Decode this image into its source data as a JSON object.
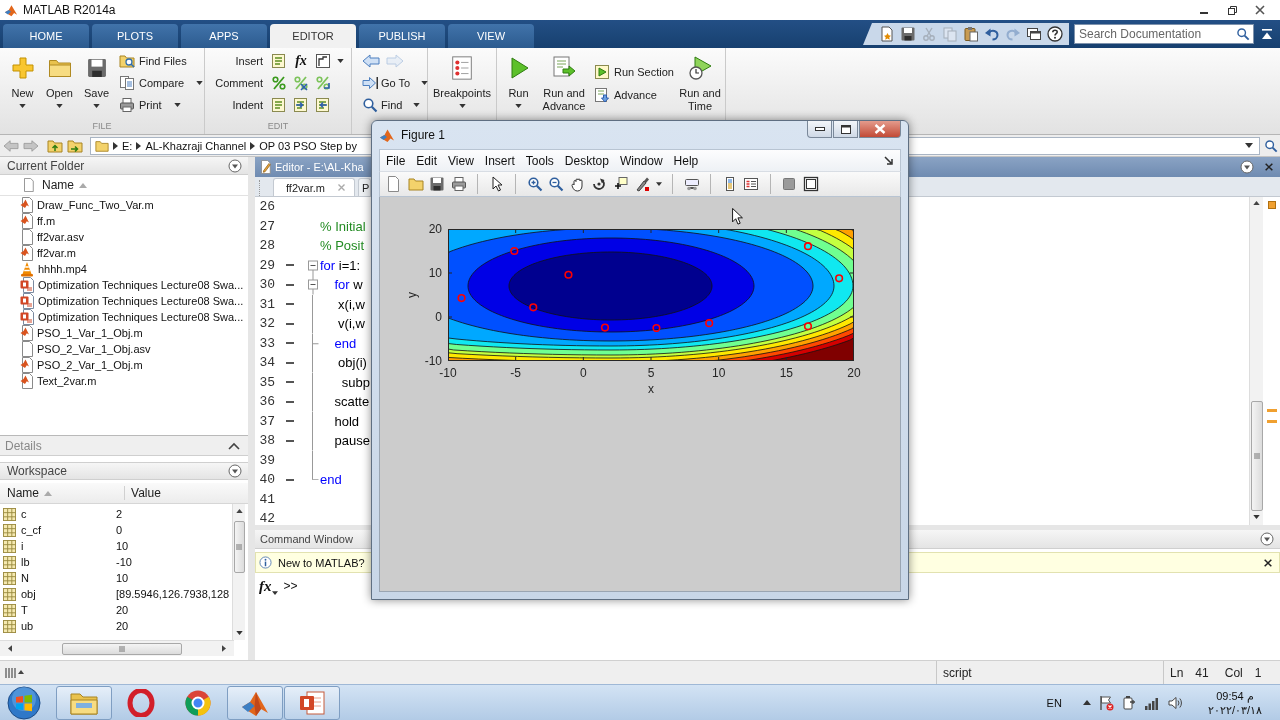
{
  "window": {
    "title": "MATLAB R2014a"
  },
  "ribbon_tabs": [
    {
      "label": "HOME",
      "selected": false
    },
    {
      "label": "PLOTS",
      "selected": false
    },
    {
      "label": "APPS",
      "selected": false
    },
    {
      "label": "EDITOR",
      "selected": true
    },
    {
      "label": "PUBLISH",
      "selected": false
    },
    {
      "label": "VIEW",
      "selected": false
    }
  ],
  "quick_access": [
    {
      "disabled": false
    },
    {
      "disabled": false
    },
    {
      "disabled": true
    },
    {
      "disabled": true
    },
    {
      "disabled": false
    },
    {
      "disabled": false
    },
    {
      "disabled": true
    },
    {
      "disabled": false
    },
    {
      "disabled": false
    }
  ],
  "search": {
    "placeholder": "Search Documentation"
  },
  "toolstrip": {
    "file": {
      "label": "FILE",
      "large_buttons": [
        {
          "label": "New",
          "dropdown": true
        },
        {
          "label": "Open",
          "dropdown": true
        },
        {
          "label": "Save",
          "dropdown": true
        }
      ],
      "small_buttons": [
        {
          "label": "Find Files",
          "dropdown": false
        },
        {
          "label": "Compare",
          "dropdown": true
        },
        {
          "label": "Print",
          "dropdown": true
        }
      ]
    },
    "edit": {
      "label": "EDIT",
      "function_glyph": "fx",
      "rows": [
        {
          "label": "Insert",
          "dropdown": true
        },
        {
          "label": "Comment",
          "dropdown": false
        },
        {
          "label": "Indent",
          "dropdown": false
        }
      ]
    },
    "navigate": {
      "arrows": [
        {
          "disabled": false
        },
        {
          "disabled": true
        }
      ],
      "buttons": [
        {
          "label": "Go To",
          "dropdown": true
        },
        {
          "label": "Find",
          "dropdown": true
        }
      ]
    },
    "breakpoints": {
      "label": "Breakpoints",
      "dropdown": true
    },
    "run": {
      "large_buttons": [
        {
          "label": "Run",
          "dropdown": true
        },
        {
          "label": "Run and Advance",
          "dropdown": false
        }
      ],
      "small_buttons": [
        {
          "label": "Run Section"
        },
        {
          "label": "Advance"
        }
      ],
      "timed": {
        "label": "Run and Time"
      }
    }
  },
  "address_bar": {
    "path": [
      "E:",
      "AL-Khazraji Channel",
      "OP 03 PSO Step by"
    ]
  },
  "current_folder": {
    "title": "Current Folder",
    "column": "Name",
    "files": [
      {
        "name": "Draw_Func_Two_Var.m",
        "kind": "m_file"
      },
      {
        "name": "ff.m",
        "kind": "m_file"
      },
      {
        "name": "ff2var.asv",
        "kind": "backup"
      },
      {
        "name": "ff2var.m",
        "kind": "m_file"
      },
      {
        "name": "hhhh.mp4",
        "kind": "video"
      },
      {
        "name": "Optimization Techniques Lecture08 Swa...",
        "kind": "presentation"
      },
      {
        "name": "Optimization Techniques Lecture08 Swa...",
        "kind": "presentation"
      },
      {
        "name": "Optimization Techniques Lecture08 Swa...",
        "kind": "presentation"
      },
      {
        "name": "PSO_1_Var_1_Obj.m",
        "kind": "m_file"
      },
      {
        "name": "PSO_2_Var_1_Obj.asv",
        "kind": "backup"
      },
      {
        "name": "PSO_2_Var_1_Obj.m",
        "kind": "m_file"
      },
      {
        "name": "Text_2var.m",
        "kind": "m_file"
      }
    ]
  },
  "details": {
    "title": "Details"
  },
  "workspace": {
    "title": "Workspace",
    "columns": [
      "Name",
      "Value"
    ],
    "rows": [
      {
        "name": "c",
        "value": "2"
      },
      {
        "name": "c_cf",
        "value": "0"
      },
      {
        "name": "i",
        "value": "10"
      },
      {
        "name": "lb",
        "value": "-10"
      },
      {
        "name": "N",
        "value": "10"
      },
      {
        "name": "obj",
        "value": "[89.5946,126.7938,128"
      },
      {
        "name": "T",
        "value": "20"
      },
      {
        "name": "ub",
        "value": "20"
      }
    ]
  },
  "editor": {
    "title": "Editor - E:\\AL-Kha",
    "tabs": [
      {
        "label": "ff2var.m",
        "selected": true
      },
      {
        "label": "P",
        "selected": false
      }
    ],
    "lines": [
      {
        "number": "26",
        "kind": "plain",
        "executable": false
      },
      {
        "number": "27",
        "kind": "plain",
        "executable": false,
        "segments": [
          {
            "text": "% Initial",
            "kind": "comment"
          }
        ]
      },
      {
        "number": "28",
        "kind": "plain",
        "executable": false,
        "segments": [
          {
            "text": "% Posit",
            "kind": "comment"
          }
        ]
      },
      {
        "number": "29",
        "kind": "opener",
        "executable": true,
        "segments": [
          {
            "text": "for",
            "kind": "keyword"
          },
          {
            "text": " i=1:",
            "kind": "plain"
          }
        ]
      },
      {
        "number": "30",
        "kind": "opener",
        "executable": true,
        "segments": [
          {
            "text": "    for",
            "kind": "keyword"
          },
          {
            "text": " w",
            "kind": "plain"
          }
        ]
      },
      {
        "number": "31",
        "kind": "inside",
        "executable": true,
        "segments": [
          {
            "text": "     x(i,w",
            "kind": "plain"
          }
        ]
      },
      {
        "number": "32",
        "kind": "inside",
        "executable": true,
        "segments": [
          {
            "text": "     v(i,w",
            "kind": "plain"
          }
        ]
      },
      {
        "number": "33",
        "kind": "closer",
        "executable": true,
        "segments": [
          {
            "text": "    end",
            "kind": "keyword"
          }
        ]
      },
      {
        "number": "34",
        "kind": "inside",
        "executable": true,
        "segments": [
          {
            "text": "     obj(i)",
            "kind": "plain"
          }
        ]
      },
      {
        "number": "35",
        "kind": "inside",
        "executable": true,
        "segments": [
          {
            "text": "      subp",
            "kind": "plain"
          }
        ]
      },
      {
        "number": "36",
        "kind": "inside",
        "executable": true,
        "segments": [
          {
            "text": "    scatte",
            "kind": "plain"
          }
        ]
      },
      {
        "number": "37",
        "kind": "inside",
        "executable": true,
        "segments": [
          {
            "text": "    hold",
            "kind": "plain"
          }
        ]
      },
      {
        "number": "38",
        "kind": "inside",
        "executable": true,
        "segments": [
          {
            "text": "    pause",
            "kind": "plain"
          }
        ]
      },
      {
        "number": "39",
        "kind": "inside",
        "executable": false
      },
      {
        "number": "40",
        "kind": "ender",
        "executable": true,
        "segments": [
          {
            "text": "end",
            "kind": "keyword"
          }
        ]
      },
      {
        "number": "41",
        "kind": "plain",
        "executable": false
      },
      {
        "number": "42",
        "kind": "plain",
        "executable": false
      }
    ]
  },
  "command_window": {
    "title": "Command Window",
    "notice": "New to MATLAB?",
    "prompt_glyph": "fx",
    "prompt": ">>"
  },
  "status_bar": {
    "mode": "script",
    "line_label": "Ln",
    "line": "41",
    "column_label": "Col",
    "column": "1"
  },
  "figure": {
    "title": "Figure 1",
    "menu": [
      "File",
      "Edit",
      "View",
      "Insert",
      "Tools",
      "Desktop",
      "Window",
      "Help"
    ],
    "chart_data": {
      "type": "scatter",
      "xlabel": "x",
      "ylabel": "y",
      "x": [
        -5.1,
        -1.1,
        -9,
        -3.7,
        1.6,
        5.4,
        9.3,
        16.6,
        18.9,
        16.6
      ],
      "series": [
        {
          "color": "#ff0000",
          "values": [
            15,
            9.6,
            4.3,
            2.2,
            -2.4,
            -2.5,
            -1.4,
            16.1,
            8.8,
            -2.1
          ]
        }
      ],
      "xlim": [
        -10,
        20
      ],
      "ylim": [
        -10,
        20
      ],
      "xticks": [
        -10,
        -5,
        0,
        5,
        10,
        15,
        20
      ],
      "yticks": [
        -10,
        0,
        10,
        20
      ]
    }
  },
  "taskbar": {
    "apps": [
      {
        "running": true
      },
      {
        "running": false
      },
      {
        "running": false
      },
      {
        "running": true
      },
      {
        "running": true
      }
    ],
    "language": "EN",
    "time": "09:54 م",
    "date": "٢٠٢٢/٠٣/١٨"
  }
}
